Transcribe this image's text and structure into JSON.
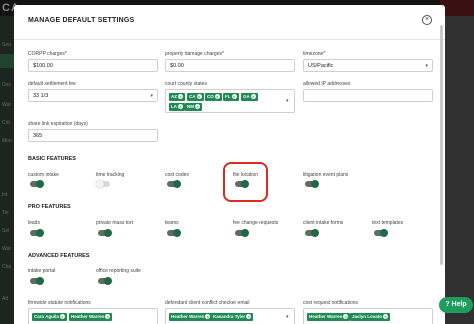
{
  "modal": {
    "title": "MANAGE DEFAULT SETTINGS",
    "close_icon": "close-icon"
  },
  "background": {
    "logo_text": "CA",
    "sidebar_labels": [
      "Sea",
      "Des",
      "Wat",
      "Crit",
      "Mon",
      "Int",
      "Ter",
      "Sol",
      "Wat",
      "Cha",
      "Ad"
    ]
  },
  "fields": {
    "corpp_charges": {
      "label": "CORPP charges*",
      "value": "$100.00"
    },
    "property_damage_charges": {
      "label": "property damage charges*",
      "value": "$0.00"
    },
    "timezone": {
      "label": "timezone*",
      "value": "US/Pacific"
    },
    "default_settlement_fee": {
      "label": "default settlement fee",
      "value": "33 1/3"
    },
    "court_county_states": {
      "label": "court county states",
      "tags": [
        "AZ",
        "CA",
        "CO",
        "FL",
        "GA",
        "LA",
        "NM"
      ]
    },
    "allowed_ip_addresses": {
      "label": "allowed IP addresses",
      "value": ""
    },
    "share_link_expiration": {
      "label": "share link expiration (days)",
      "value": "365"
    }
  },
  "sections": {
    "basic": {
      "title": "BASIC FEATURES",
      "toggles": [
        {
          "label": "custom intake",
          "on": true
        },
        {
          "label": "time tracking",
          "on": false
        },
        {
          "label": "cost codes",
          "on": true
        },
        {
          "label": "file location",
          "on": true
        },
        {
          "label": "litigation event plans",
          "on": true
        }
      ]
    },
    "pro": {
      "title": "PRO FEATURES",
      "toggles": [
        {
          "label": "leads",
          "on": true
        },
        {
          "label": "private mass tort",
          "on": true
        },
        {
          "label": "teams",
          "on": true
        },
        {
          "label": "fee change requests",
          "on": true
        },
        {
          "label": "client intake forms",
          "on": true
        },
        {
          "label": "text templates",
          "on": true
        }
      ]
    },
    "advanced": {
      "title": "ADVANCED FEATURES",
      "toggles": [
        {
          "label": "intake portal",
          "on": true
        },
        {
          "label": "office reporting suite",
          "on": true
        }
      ]
    }
  },
  "notifications": {
    "firmwide_statute": {
      "label": "firmwide statute notifications",
      "tags": [
        "Cara Aguila",
        "Heather Warren"
      ]
    },
    "defendant_conflict": {
      "label": "defendant client conflict checker email",
      "tags": [
        "Heather Warren",
        "Kasandra Tyler"
      ]
    },
    "cost_request": {
      "label": "cost request notifications",
      "tags": [
        "Heather Warren",
        "Jaclyn Lovato"
      ]
    }
  },
  "help_button": "Help",
  "colors": {
    "accent_green": "#1f8a52",
    "highlight_red": "#d92d20"
  }
}
